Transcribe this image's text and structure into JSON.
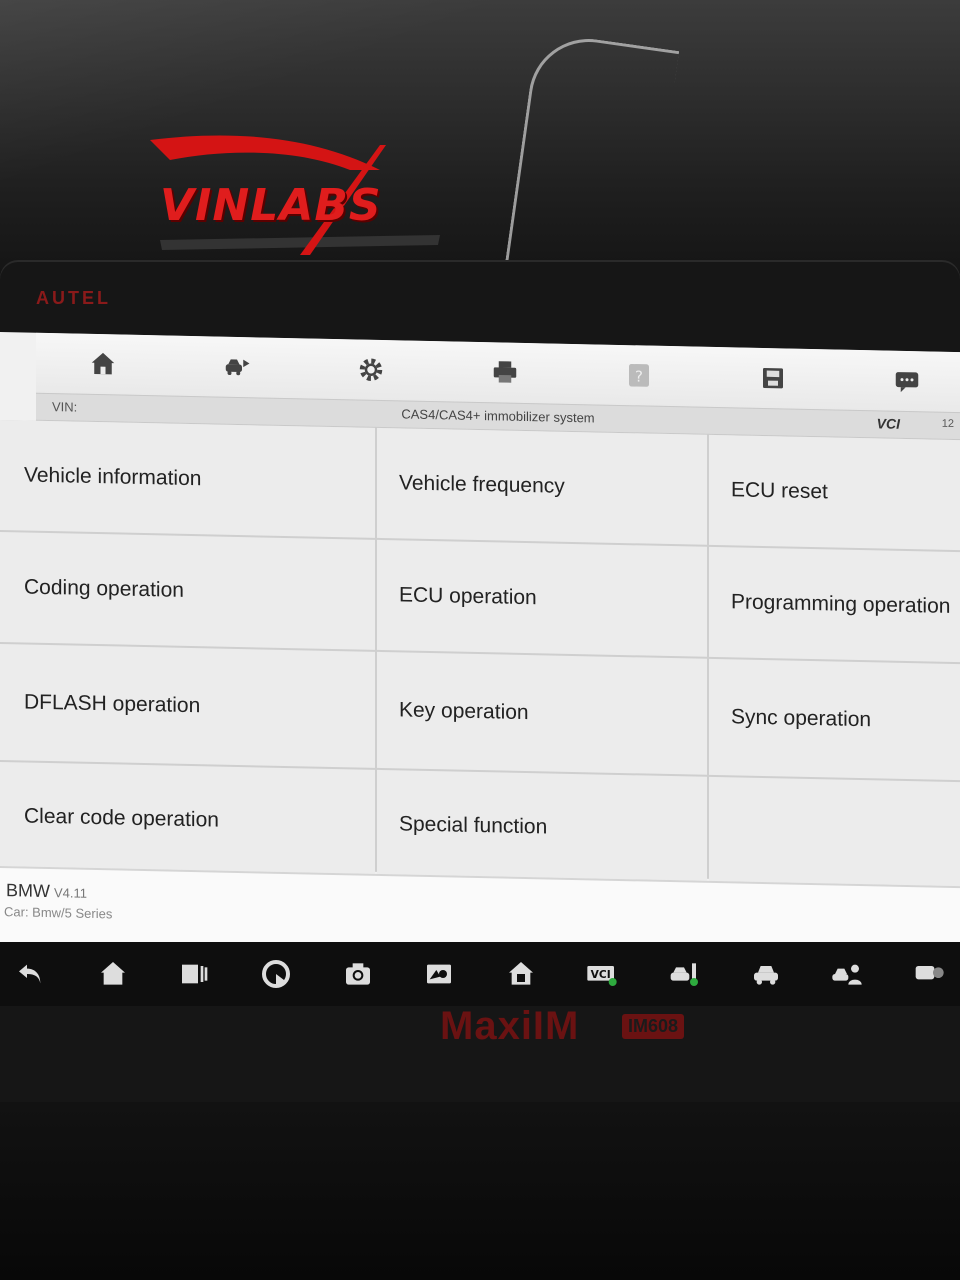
{
  "watermark": {
    "text": "VINLABS"
  },
  "device": {
    "brand": "AUTEL",
    "model": "MaxiIM",
    "model_badge": "IM608"
  },
  "toolbar": {
    "icons": [
      "home-icon",
      "car-swap-icon",
      "gear-icon",
      "printer-icon",
      "help-icon",
      "save-icon",
      "message-icon"
    ]
  },
  "titlebar": {
    "vin_label": "VIN:",
    "title": "CAS4/CAS4+ immobilizer system",
    "vci": "VCI",
    "battery": "12"
  },
  "menu": {
    "items": [
      "Vehicle information",
      "Vehicle frequency",
      "ECU reset",
      "Coding operation",
      "ECU operation",
      "Programming operation",
      "DFLASH operation",
      "Key operation",
      "Sync operation",
      "Clear code operation",
      "Special function",
      ""
    ]
  },
  "vehicle": {
    "make": "BMW",
    "version": "V4.11",
    "car": "Car: Bmw/5 Series"
  },
  "navbar": {
    "icons": [
      "back-icon",
      "home-icon",
      "recent-apps-icon",
      "browser-icon",
      "camera-icon",
      "display-icon",
      "home-alt-icon",
      "vci-icon",
      "car-key-icon",
      "car-icon",
      "support-icon",
      "message-icon"
    ]
  }
}
